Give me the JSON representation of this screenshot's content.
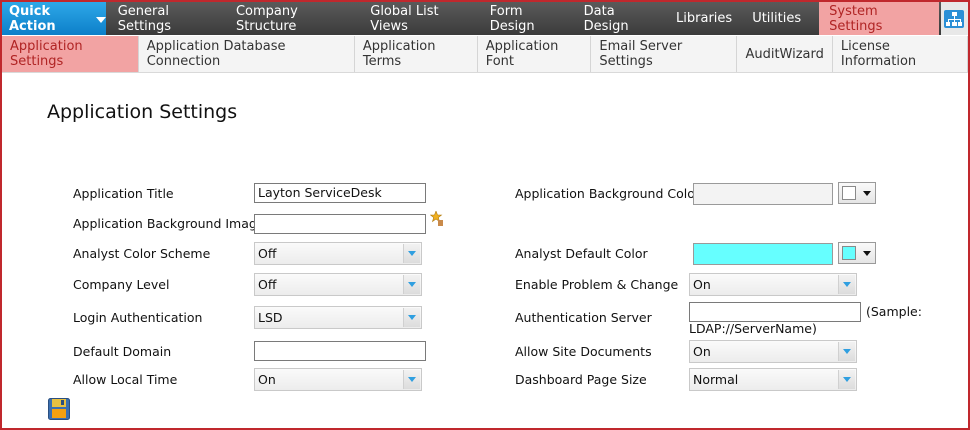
{
  "topnav": {
    "quick_action": "Quick Action",
    "items": [
      "General Settings",
      "Company Structure",
      "Global List Views",
      "Form Design",
      "Data Design",
      "Libraries",
      "Utilities"
    ],
    "active_item": "System Settings",
    "accent": "#1a8fd8",
    "active_bg": "#f2a3a3"
  },
  "subnav": {
    "active_tab": "Application Settings",
    "tabs": [
      "Application Database Connection",
      "Application Terms",
      "Application Font",
      "Email Server Settings",
      "AuditWizard",
      "License Information"
    ]
  },
  "page": {
    "title": "Application Settings"
  },
  "form": {
    "app_title": {
      "label": "Application Title",
      "value": "Layton ServiceDesk"
    },
    "app_bg_image": {
      "label": "Application Background Image",
      "value": ""
    },
    "analyst_color_scheme": {
      "label": "Analyst Color Scheme",
      "value": "Off"
    },
    "company_level": {
      "label": "Company Level",
      "value": "Off"
    },
    "login_auth": {
      "label": "Login Authentication",
      "value": "LSD"
    },
    "default_domain": {
      "label": "Default Domain",
      "value": ""
    },
    "allow_local_time": {
      "label": "Allow Local Time",
      "value": "On"
    },
    "app_bg_color": {
      "label": "Application Background Color",
      "color": "#f3f3f3"
    },
    "analyst_default_color": {
      "label": "Analyst Default Color",
      "color": "#66ffff"
    },
    "enable_problem_change": {
      "label": "Enable Problem & Change",
      "value": "On"
    },
    "auth_server": {
      "label": "Authentication Server",
      "value": "",
      "sample_prefix": "(Sample:",
      "sample_value": "LDAP://ServerName)"
    },
    "allow_site_docs": {
      "label": "Allow Site Documents",
      "value": "On"
    },
    "dashboard_page_size": {
      "label": "Dashboard Page Size",
      "value": "Normal"
    }
  },
  "icons": {
    "browse": "star-browse-icon",
    "save": "save-icon",
    "sitemap": "sitemap-icon"
  }
}
